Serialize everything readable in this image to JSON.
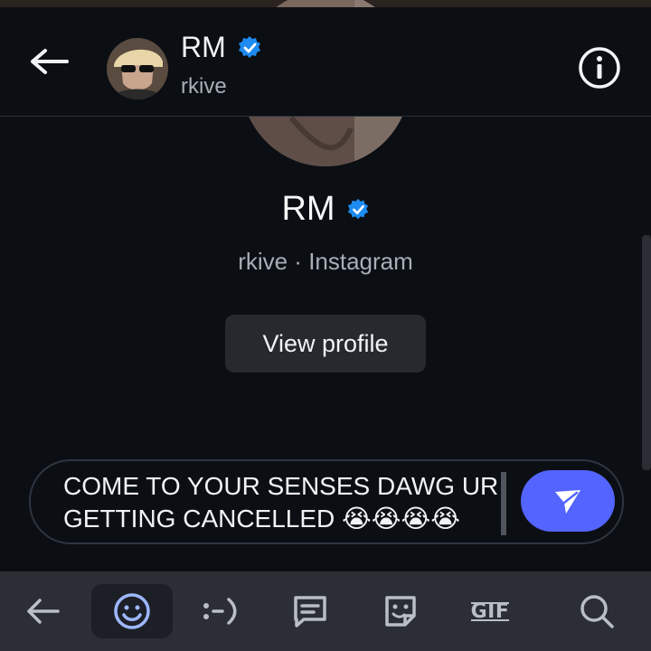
{
  "header": {
    "title": "RM",
    "handle": "rkive"
  },
  "profile": {
    "name": "RM",
    "subtitle": "rkive · Instagram",
    "view_profile_label": "View profile"
  },
  "composer": {
    "message": "COME TO YOUR SENSES DAWG UR GETTING CANCELLED 😭😭😭😭"
  },
  "keyboard_toolbar": {
    "items": [
      "back-icon",
      "emoji-icon",
      "emoticon-icon",
      "message-icon",
      "sticker-icon",
      "gif-icon",
      "search-icon"
    ],
    "selected": "emoji-icon",
    "gif_label": "GIF"
  },
  "colors": {
    "background": "#0b0f14",
    "accent_send": "#5464ff",
    "verified": "#1d8bf1"
  }
}
